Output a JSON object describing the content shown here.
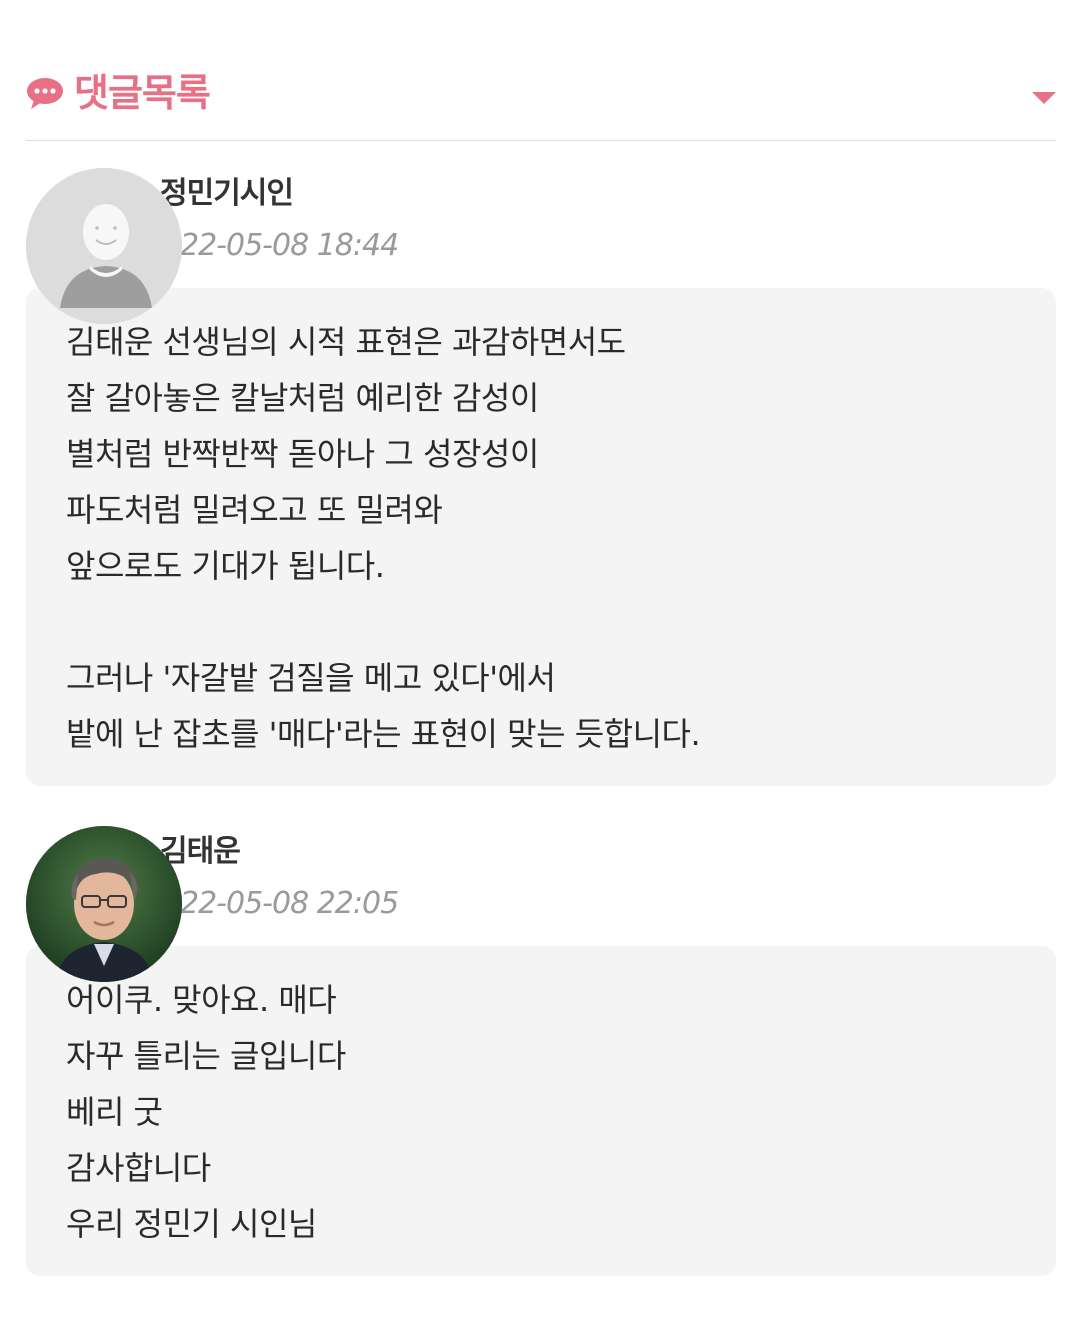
{
  "header": {
    "title": "댓글목록",
    "icon": "speech-bubble-icon",
    "toggle_icon": "caret-down-icon",
    "accent_color": "#e86f84"
  },
  "comments": [
    {
      "author": "정민기시인",
      "date": "22-05-08 18:44",
      "avatar": "default-avatar-icon",
      "lines": [
        "김태운 선생님의 시적 표현은 과감하면서도",
        "잘 갈아놓은 칼날처럼 예리한 감성이",
        "별처럼 반짝반짝 돋아나 그 성장성이",
        "파도처럼 밀려오고 또 밀려와",
        "앞으로도 기대가 됩니다.",
        "",
        "그러나 '자갈밭 검질을 메고 있다'에서",
        "밭에 난 잡초를 '매다'라는 표현이 맞는 듯합니다."
      ]
    },
    {
      "author": "김태운",
      "date": "22-05-08 22:05",
      "avatar": "user-photo-avatar",
      "lines": [
        "어이쿠. 맞아요. 매다",
        "자꾸 틀리는 글입니다",
        "베리 굿",
        "감사합니다",
        "우리 정민기 시인님"
      ]
    }
  ]
}
